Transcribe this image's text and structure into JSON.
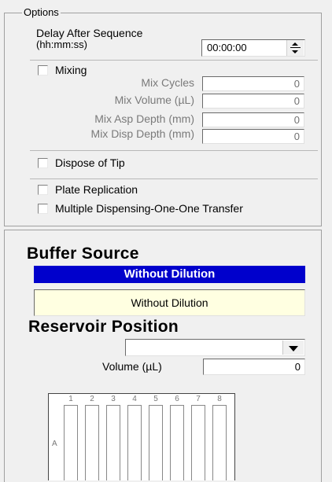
{
  "options": {
    "legend": "Options",
    "delay_label_line1": "Delay After Sequence",
    "delay_label_line2": "(hh:mm:ss)",
    "delay_value": "00:00:00",
    "mixing_label": "Mixing",
    "mix_cycles_label": "Mix Cycles",
    "mix_cycles_value": "0",
    "mix_volume_label": "Mix Volume (µL)",
    "mix_volume_value": "0",
    "mix_asp_label": "Mix Asp Depth (mm)",
    "mix_asp_value": "0",
    "mix_disp_label": "Mix Disp Depth (mm)",
    "mix_disp_value": "0",
    "dispose_label": "Dispose of Tip",
    "plate_rep_label": "Plate Replication",
    "multi_disp_label": "Multiple Dispensing-One-One Transfer"
  },
  "buffer": {
    "title": "Buffer Source",
    "header": "Without Dilution",
    "box_text": "Without Dilution",
    "reservoir_title": "Reservoir Position",
    "reservoir_selected": "",
    "volume_label": "Volume (µL)",
    "volume_value": "0"
  },
  "plate": {
    "columns": [
      "1",
      "2",
      "3",
      "4",
      "5",
      "6",
      "7",
      "8"
    ],
    "row_label": "A"
  },
  "colors": {
    "header_bg": "#0000cc",
    "header_text": "#ffffff",
    "box_bg": "#ffffe1"
  }
}
